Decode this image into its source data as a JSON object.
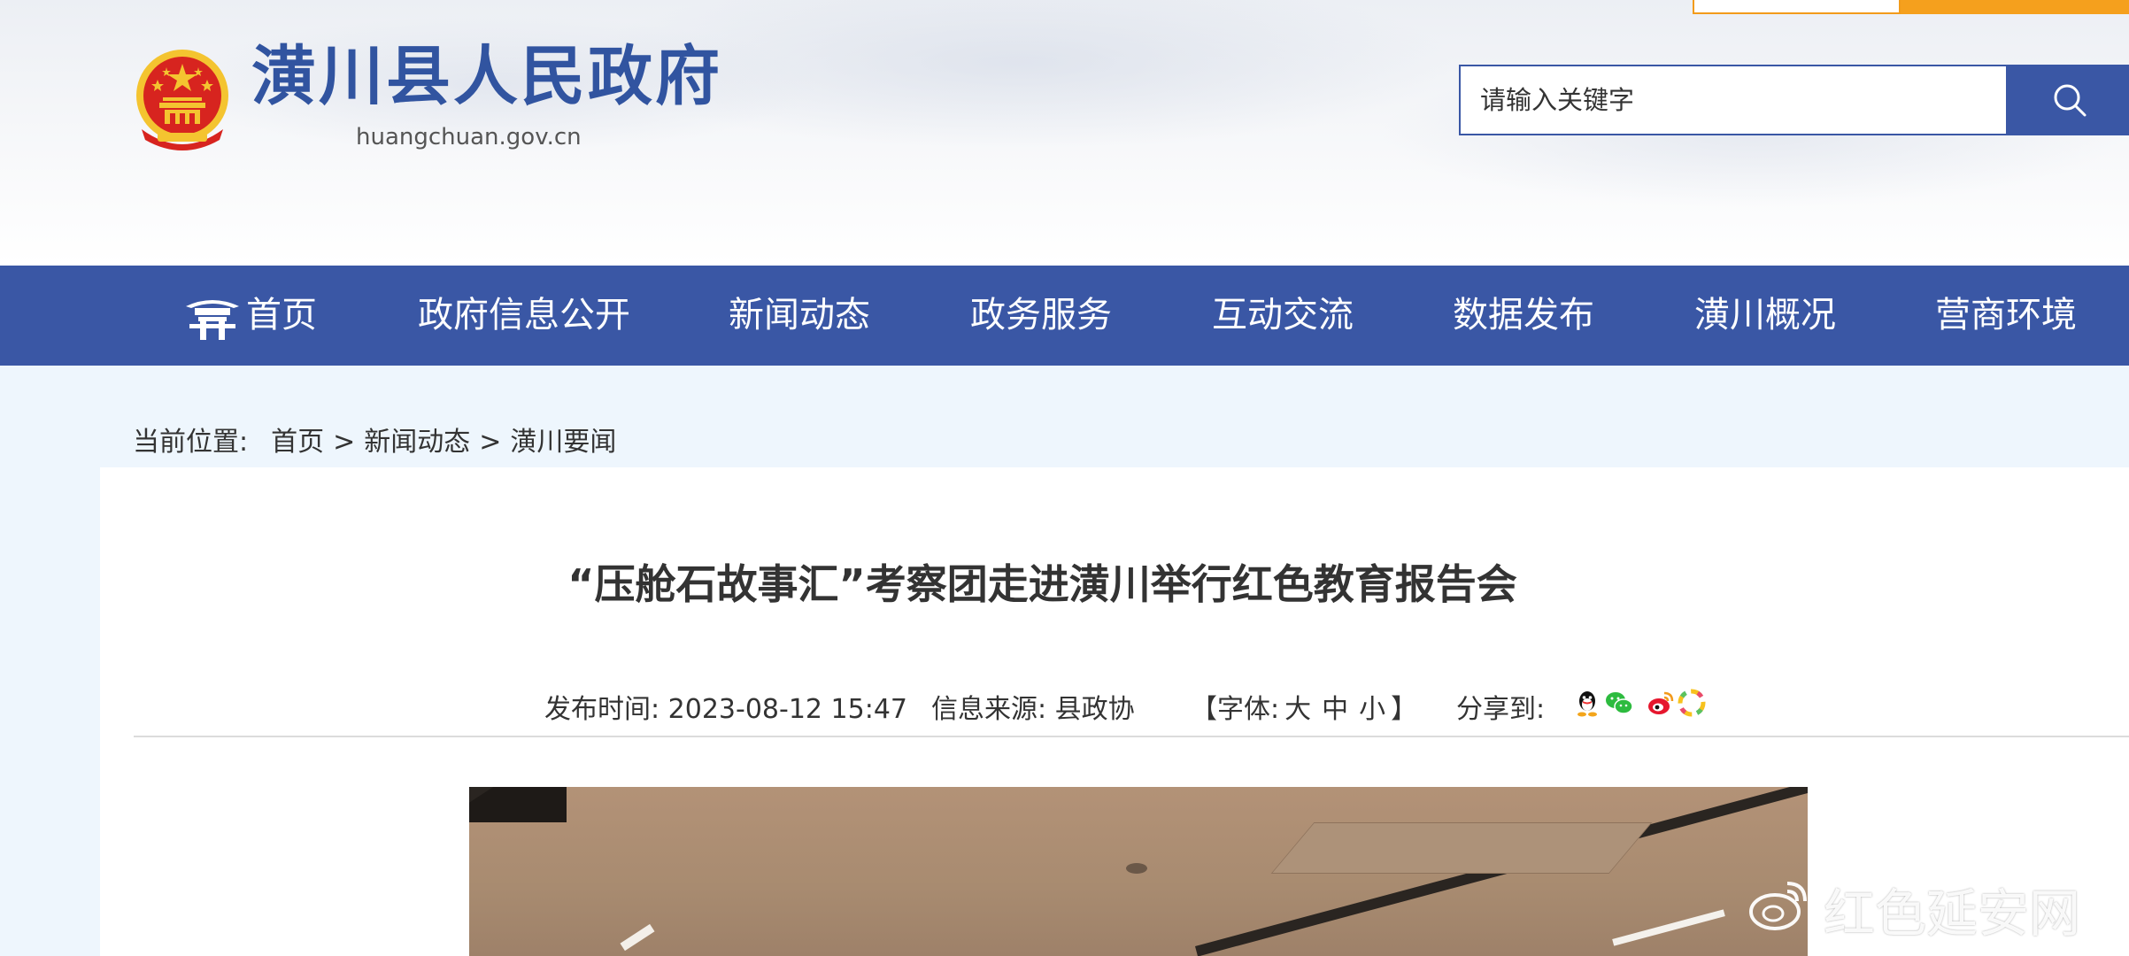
{
  "header": {
    "site_title": "潢川县人民政府",
    "site_domain": "huangchuan.gov.cn",
    "emblem_icon": "national-emblem-icon",
    "search": {
      "placeholder": "请输入关键字",
      "button_icon": "search-icon"
    }
  },
  "nav": {
    "items": [
      {
        "label": "首页",
        "icon": "home-gate-icon"
      },
      {
        "label": "政府信息公开"
      },
      {
        "label": "新闻动态"
      },
      {
        "label": "政务服务"
      },
      {
        "label": "互动交流"
      },
      {
        "label": "数据发布"
      },
      {
        "label": "潢川概况"
      },
      {
        "label": "营商环境"
      }
    ]
  },
  "breadcrumb": {
    "label": "当前位置:",
    "items": [
      "首页",
      "新闻动态",
      "潢川要闻"
    ],
    "separator": ">"
  },
  "article": {
    "title": "“压舱石故事汇”考察团走进潢川举行红色教育报告会",
    "publish_label": "发布时间:",
    "publish_time": "2023-08-12 15:47",
    "source_label": "信息来源:",
    "source": "县政协",
    "font_open": "【字体:",
    "font_large": "大",
    "font_medium": "中",
    "font_small": "小",
    "font_close": "】",
    "share_label": "分享到:",
    "share_icons": [
      "qq-icon",
      "wechat-icon",
      "weibo-icon",
      "moments-icon"
    ]
  },
  "watermark": {
    "text": "红色延安网",
    "icon": "weibo-icon"
  },
  "colors": {
    "primary_blue": "#3a57a5",
    "accent_orange": "#f5a01d",
    "emblem_red": "#d7241f",
    "emblem_gold": "#f4c430"
  }
}
